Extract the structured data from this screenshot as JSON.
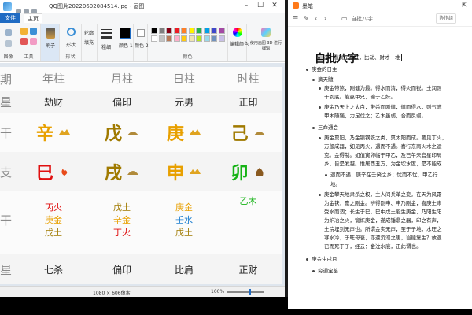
{
  "paint": {
    "title": "QQ图片20220602084514.jpg - 画图",
    "file_menu": "文件",
    "home_tab": "主页",
    "groups": {
      "clipboard": "",
      "image": "图像",
      "tools": "工具",
      "shapes": "形状",
      "colors": "颜色"
    },
    "buttons": {
      "brush": "刷子",
      "shapes": "形状",
      "outline": "轮廓",
      "fill": "填充",
      "size": "粗细",
      "color1": "颜色 1",
      "color2": "颜色 2",
      "edit_colors": "编辑颜色",
      "paint3d": "使用画图 3D 进行编辑"
    },
    "palette": [
      "#000000",
      "#7f7f7f",
      "#880015",
      "#ed1c24",
      "#ff7f27",
      "#fff200",
      "#22b14c",
      "#00a2e8",
      "#3f48cc",
      "#a349a4",
      "#ffffff",
      "#c3c3c3",
      "#b97a57",
      "#ffaec9",
      "#ffc90e",
      "#efe4b0",
      "#b5e61d",
      "#99d9ea",
      "#7092be",
      "#c8bfe7"
    ],
    "status": {
      "dims": "1080 × 606像素",
      "zoom": "100%"
    }
  },
  "bazi": {
    "row_labels": [
      "期",
      "星",
      "干",
      "支",
      "干",
      "星"
    ],
    "headers": [
      "年柱",
      "月柱",
      "日柱",
      "时柱"
    ],
    "ten_gods_top": [
      "劫财",
      "偏印",
      "元男",
      "正印"
    ],
    "stems": [
      {
        "char": "辛",
        "color": "#e8a000"
      },
      {
        "char": "戊",
        "color": "#a07a00"
      },
      {
        "char": "庚",
        "color": "#e8a000"
      },
      {
        "char": "己",
        "color": "#a07a00"
      }
    ],
    "branches": [
      {
        "char": "巳",
        "color": "#e01010"
      },
      {
        "char": "戌",
        "color": "#a07a00"
      },
      {
        "char": "申",
        "color": "#e8a000"
      },
      {
        "char": "卯",
        "color": "#16b316"
      }
    ],
    "hidden": [
      [
        {
          "t": "丙火",
          "c": "#e01010"
        },
        {
          "t": "庚金",
          "c": "#e8a000"
        },
        {
          "t": "戊土",
          "c": "#a07a00"
        }
      ],
      [
        {
          "t": "戊土",
          "c": "#a07a00"
        },
        {
          "t": "辛金",
          "c": "#e8a000"
        },
        {
          "t": "丁火",
          "c": "#e01010"
        }
      ],
      [
        {
          "t": "庚金",
          "c": "#e8a000"
        },
        {
          "t": "壬水",
          "c": "#1e7fd0"
        },
        {
          "t": "戊土",
          "c": "#a07a00"
        }
      ],
      [
        {
          "t": "乙木",
          "c": "#16b316"
        }
      ]
    ],
    "ten_gods_bottom": [
      "七杀",
      "偏印",
      "比肩",
      "正财"
    ]
  },
  "note": {
    "window_title": "墨笔",
    "breadcrumb": "自批八字",
    "share_label": "协作组",
    "heading": "自批八字",
    "items": [
      "这一看就是身旺，比劫、财才一堆",
      "庚金的日主",
      "滴天髓",
      "庚金带煞，刚健为最。得水而清，得火而锐。土润则",
      "干到底。能赢甲兄，输于乙妹。",
      "庚金乃天上之太白，带杀而刚健，健而得水，则气流",
      "甲木随强，力足伐之；乙木虽弱，合而反弱。",
      "三命通会",
      "庚金禀阳，乃金银钢铁之类，禀太阳而成。要见丁火，",
      "万般成器，如见丙火，遇而不遇。喜行东南火木之运",
      "克。金得制。如值寅卯临于甲乙，及已午未官星印局",
      "乡，皆是发越。惟居酉丑方，为金坎水度，是不能成",
      "遇而不遇，庚辛在壬癸之乡；忧而不忧，甲乙行",
      "地。",
      "庚金攀天地肃杀之权，主人间兵革之变。在天为风霜",
      "为金铁，禀之刚金。辨得刚申、申乃刚金，喜庚土肃",
      "受水而涸；长生于巳，巳中戊土能生庚金，乃阳生阳",
      "为炉冶之火，锻炼庚金，遂成锤鼎之器，印之有声，",
      "土浣埋到无声也。所谓金实无声，至于子地，水旺之",
      "寒水冷，子旺母衰，亦遭沉溺之患，岂能复生？故遇",
      "已而死于子，经云：金沈水底，正此谓也。",
      "庚金生戌月",
      "穷通宝鉴"
    ]
  }
}
